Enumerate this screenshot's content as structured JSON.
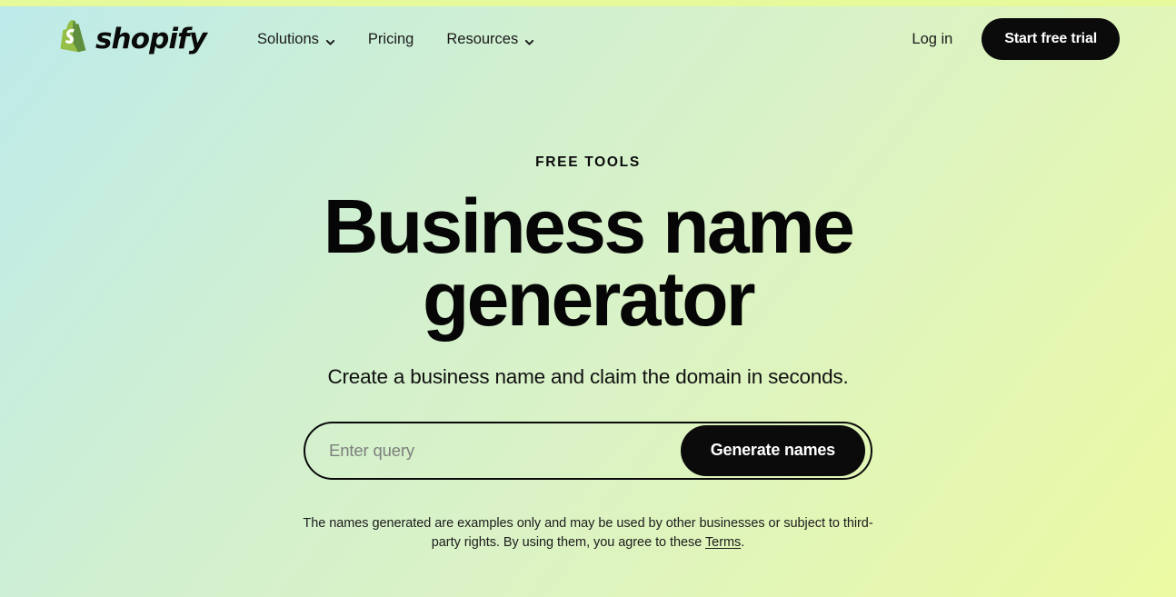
{
  "theme": {
    "gradient_start": "#bdeaea",
    "gradient_end": "#ecfaa3",
    "top_sliver": "#e6fa9c",
    "button_bg": "#0b0b0b",
    "button_text": "#ffffff",
    "text_color": "#0a0a0a",
    "placeholder_color": "#7c7f7c"
  },
  "header": {
    "brand_name": "shopify",
    "nav": [
      {
        "label": "Solutions",
        "has_dropdown": true,
        "icon": "chevron-down-icon"
      },
      {
        "label": "Pricing",
        "has_dropdown": false,
        "icon": ""
      },
      {
        "label": "Resources",
        "has_dropdown": true,
        "icon": "chevron-down-icon"
      }
    ],
    "login_label": "Log in",
    "cta_label": "Start free trial"
  },
  "hero": {
    "eyebrow": "FREE TOOLS",
    "title": "Business name generator",
    "subtitle": "Create a business name and claim the domain in seconds."
  },
  "search": {
    "placeholder": "Enter query",
    "value": "",
    "button_label": "Generate names"
  },
  "disclaimer": {
    "text_before": "The names generated are examples only and may be used by other businesses or subject to third-party rights. By using them, you agree to these ",
    "link_label": "Terms",
    "text_after": "."
  }
}
